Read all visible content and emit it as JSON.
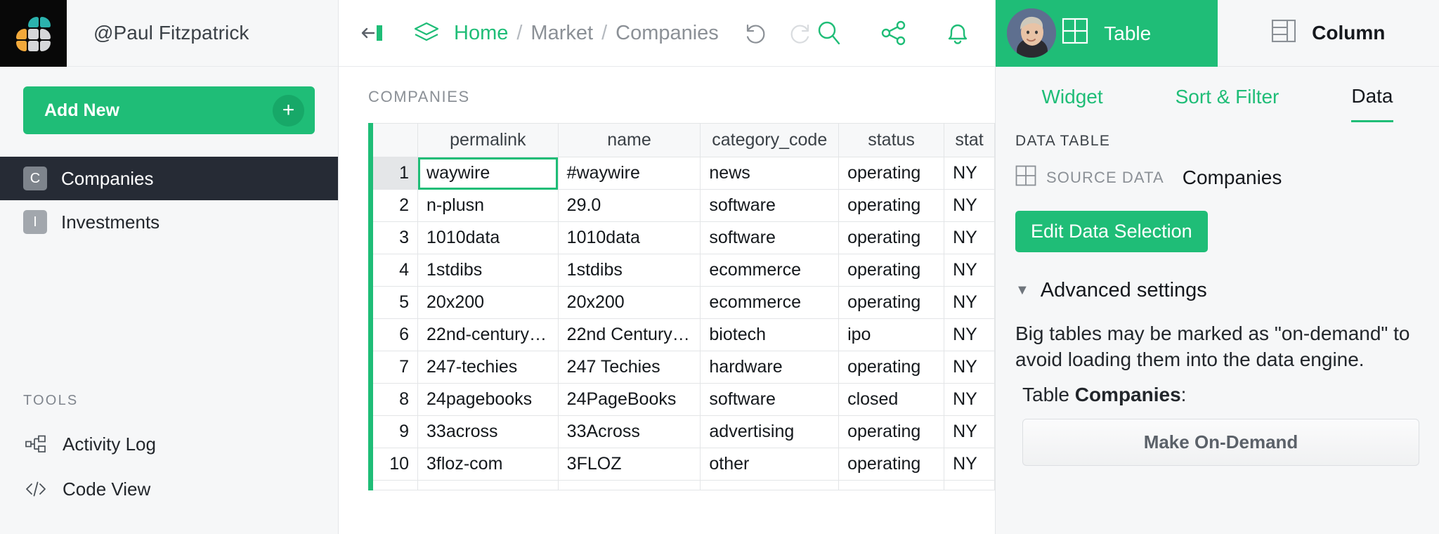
{
  "brand": {
    "logo_icon": "grid-petals-logo",
    "username": "@Paul Fitzpatrick"
  },
  "sidebar": {
    "add_new_label": "Add New",
    "add_new_plus": "+",
    "items": [
      {
        "badge": "C",
        "label": "Companies",
        "active": true
      },
      {
        "badge": "I",
        "label": "Investments",
        "active": false
      }
    ],
    "tools_label": "TOOLS",
    "tools": [
      {
        "icon": "activity-log-icon",
        "label": "Activity Log"
      },
      {
        "icon": "code-view-icon",
        "label": "Code View"
      }
    ]
  },
  "topbar": {
    "collapse_icon": "collapse-panel-icon",
    "layers_icon": "layers-icon",
    "breadcrumbs": [
      {
        "label": "Home",
        "current": false,
        "accent": true
      },
      {
        "label": "Market",
        "current": false,
        "accent": false
      },
      {
        "label": "Companies",
        "current": true,
        "accent": false
      }
    ],
    "separator": "/",
    "undo_icon": "undo-icon",
    "redo_icon": "redo-icon",
    "search_icon": "search-icon",
    "share_icon": "share-icon",
    "bell_icon": "bell-icon",
    "avatar_icon": "user-avatar",
    "logout_icon": "logout-icon"
  },
  "widget": {
    "title": "COMPANIES",
    "more_icon": "more-options-icon",
    "columns": [
      "",
      "permalink",
      "name",
      "category_code",
      "status",
      "stat"
    ],
    "selected_column": "permalink",
    "selected_cell": {
      "row": 1,
      "column": "permalink"
    },
    "rows": [
      {
        "n": "1",
        "permalink": "waywire",
        "name": "#waywire",
        "category_code": "news",
        "status": "operating",
        "stat": "NY"
      },
      {
        "n": "2",
        "permalink": "n-plusn",
        "name": "29.0",
        "category_code": "software",
        "status": "operating",
        "stat": "NY"
      },
      {
        "n": "3",
        "permalink": "1010data",
        "name": "1010data",
        "category_code": "software",
        "status": "operating",
        "stat": "NY"
      },
      {
        "n": "4",
        "permalink": "1stdibs",
        "name": "1stdibs",
        "category_code": "ecommerce",
        "status": "operating",
        "stat": "NY"
      },
      {
        "n": "5",
        "permalink": "20x200",
        "name": "20x200",
        "category_code": "ecommerce",
        "status": "operating",
        "stat": "NY"
      },
      {
        "n": "6",
        "permalink": "22nd-century…",
        "name": "22nd Century…",
        "category_code": "biotech",
        "status": "ipo",
        "stat": "NY"
      },
      {
        "n": "7",
        "permalink": "247-techies",
        "name": "247 Techies",
        "category_code": "hardware",
        "status": "operating",
        "stat": "NY"
      },
      {
        "n": "8",
        "permalink": "24pagebooks",
        "name": "24PageBooks",
        "category_code": "software",
        "status": "closed",
        "stat": "NY"
      },
      {
        "n": "9",
        "permalink": "33across",
        "name": "33Across",
        "category_code": "advertising",
        "status": "operating",
        "stat": "NY"
      },
      {
        "n": "10",
        "permalink": "3floz-com",
        "name": "3FLOZ",
        "category_code": "other",
        "status": "operating",
        "stat": "NY"
      }
    ]
  },
  "rightpanel": {
    "tabs": [
      {
        "label": "Table",
        "icon": "table-grid-icon",
        "active": true
      },
      {
        "label": "Column",
        "icon": "column-layout-icon",
        "active": false
      }
    ],
    "subtabs": [
      {
        "label": "Widget",
        "active": false
      },
      {
        "label": "Sort & Filter",
        "active": false
      },
      {
        "label": "Data",
        "active": true
      }
    ],
    "section_label": "DATA TABLE",
    "source_icon": "table-grid-icon",
    "source_label": "SOURCE DATA",
    "source_value": "Companies",
    "edit_button": "Edit Data Selection",
    "advanced_caret": "▼",
    "advanced_title": "Advanced settings",
    "advanced_text": "Big tables may be marked as \"on-demand\" to avoid loading them into the data engine.",
    "table_prefix": "Table ",
    "table_name": "Companies",
    "table_suffix": ":",
    "on_demand_button": "Make On-Demand"
  },
  "colors": {
    "accent": "#1fbd77",
    "dark_nav": "#262b35",
    "panel_bg": "#f6f7f8",
    "muted_text": "#8b9096",
    "logo_teal": "#2bb3ae",
    "logo_orange": "#f2a93b",
    "logo_gray": "#d6d7d9"
  }
}
